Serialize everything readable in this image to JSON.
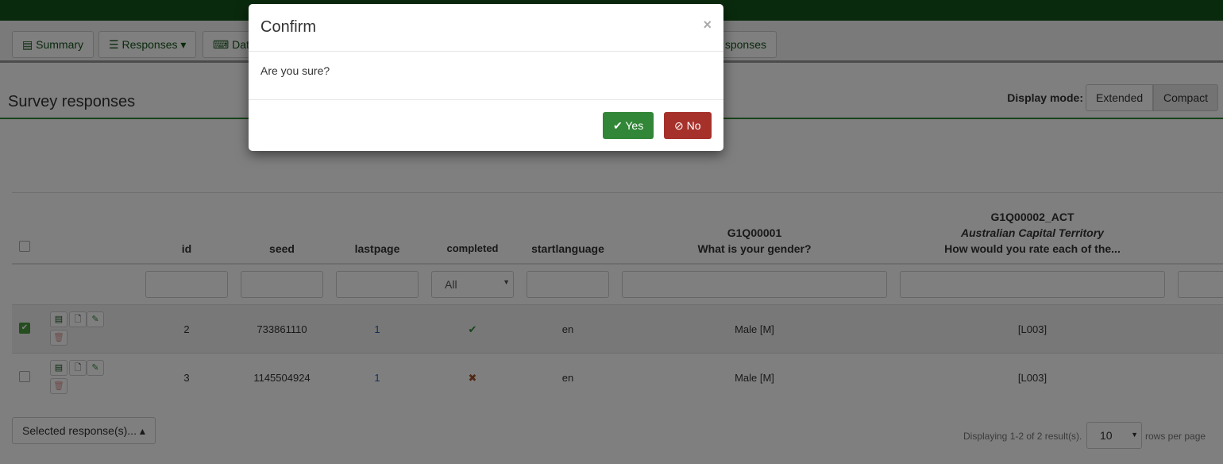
{
  "toolbar": {
    "summary": "Summary",
    "responses": "Responses",
    "data": "Data",
    "more": "sponses"
  },
  "page": {
    "title": "Survey responses",
    "display_mode_label": "Display mode:",
    "extended": "Extended",
    "compact": "Compact"
  },
  "table": {
    "headers": {
      "id": "id",
      "seed": "seed",
      "lastpage": "lastpage",
      "completed": "completed",
      "startlanguage": "startlanguage",
      "g1_code": "G1Q00001",
      "g1_text": "What is your gender?",
      "g2_code": "G1Q00002_ACT",
      "g2_sub": "Australian Capital Territory",
      "g2_text": "How would you rate each of the..."
    },
    "completed_filter": "All",
    "rows": [
      {
        "id": "2",
        "seed": "733861110",
        "lastpage": "1",
        "completed": "✔",
        "startlanguage": "en",
        "gender": "Male [M]",
        "act": "[L003]",
        "checked": true
      },
      {
        "id": "3",
        "seed": "1145504924",
        "lastpage": "1",
        "completed": "✖",
        "startlanguage": "en",
        "gender": "Male [M]",
        "act": "[L003]",
        "checked": false
      }
    ]
  },
  "footer": {
    "selected": "Selected response(s)...",
    "displaying": "Displaying 1-2 of 2 result(s).",
    "page_size": "10",
    "rows_per_page": "rows per page"
  },
  "modal": {
    "title": "Confirm",
    "close": "×",
    "body": "Are you sure?",
    "yes": "Yes",
    "no": "No"
  },
  "colors": {
    "yes": "#328637",
    "no": "#a6312b",
    "brand": "#14541a"
  }
}
